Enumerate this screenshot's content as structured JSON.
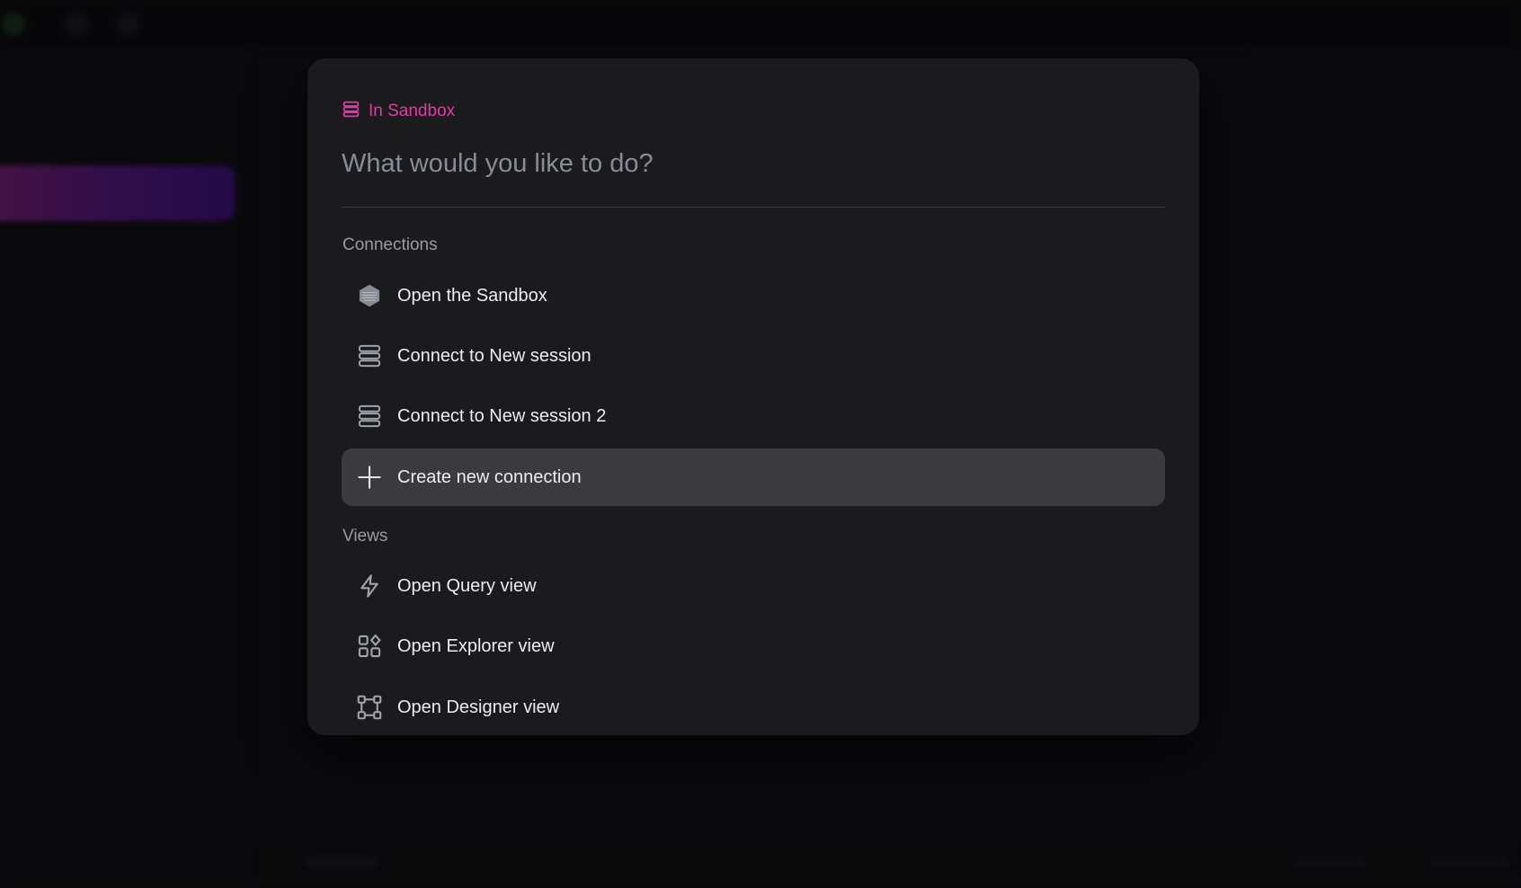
{
  "palette": {
    "scope_label": "In Sandbox",
    "search_placeholder": "What would you like to do?",
    "search_value": "",
    "sections": [
      {
        "title": "Connections",
        "items": [
          {
            "label": "Open the Sandbox",
            "icon": "cube-icon"
          },
          {
            "label": "Connect to New session",
            "icon": "database-icon"
          },
          {
            "label": "Connect to New session 2",
            "icon": "database-icon"
          },
          {
            "label": "Create new connection",
            "icon": "plus-icon",
            "selected": true
          }
        ]
      },
      {
        "title": "Views",
        "items": [
          {
            "label": "Open Query view",
            "icon": "lightning-icon"
          },
          {
            "label": "Open Explorer view",
            "icon": "grid-shapes-icon"
          },
          {
            "label": "Open Designer view",
            "icon": "diagram-icon"
          }
        ]
      }
    ]
  },
  "colors": {
    "accent": "#e03ba8",
    "panel": "#1b1b1e",
    "selected": "#3b3b3f",
    "sidebar_gradient_start": "#a3239c",
    "sidebar_gradient_end": "#4a0fa0"
  }
}
